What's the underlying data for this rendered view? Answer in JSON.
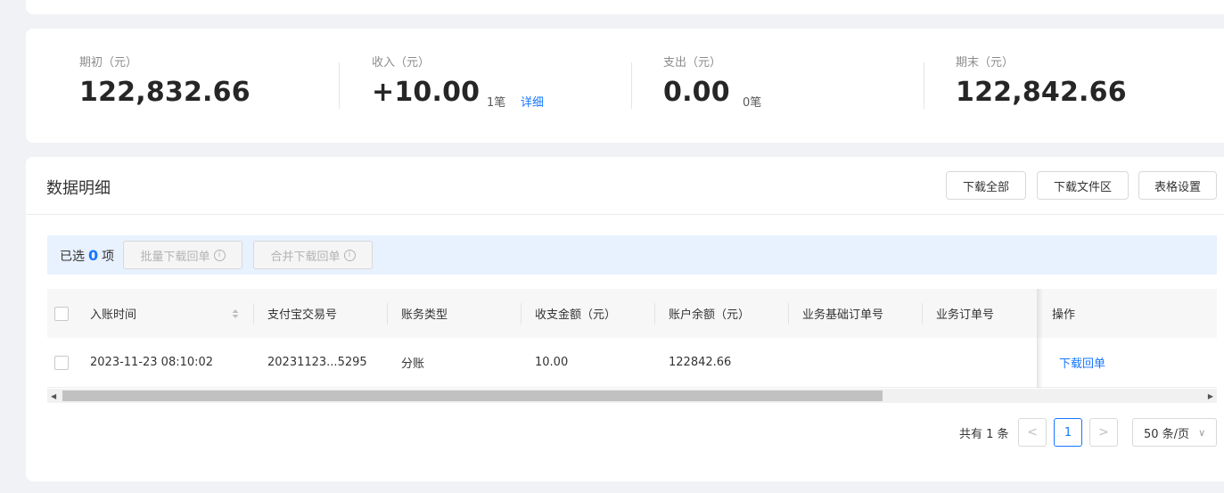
{
  "summary": {
    "opening": {
      "label": "期初（元）",
      "value": "122,832.66"
    },
    "income": {
      "label": "收入（元）",
      "value": "+10.00",
      "count": "1笔",
      "detail_link": "详细"
    },
    "expense": {
      "label": "支出（元）",
      "value": "0.00",
      "count": "0笔"
    },
    "closing": {
      "label": "期末（元）",
      "value": "122,842.66"
    }
  },
  "detail": {
    "title": "数据明细",
    "buttons": {
      "download_all": "下载全部",
      "download_area": "下载文件区",
      "table_settings": "表格设置"
    },
    "selection": {
      "prefix": "已选",
      "count": "0",
      "suffix": "项",
      "batch_download": "批量下载回单",
      "merge_download": "合并下载回单"
    },
    "columns": [
      "入账时间",
      "支付宝交易号",
      "账务类型",
      "收支金额（元）",
      "账户余额（元）",
      "业务基础订单号",
      "业务订单号",
      "操作"
    ],
    "rows": [
      {
        "time": "2023-11-23 08:10:02",
        "trade_no": "20231123...5295",
        "type": "分账",
        "amount": "10.00",
        "balance": "122842.66",
        "base_order": "",
        "order": "",
        "action": "下载回单"
      }
    ],
    "scrollbar": {
      "thumb_fraction": 0.72
    },
    "pagination": {
      "total_text": "共有 1 条",
      "current_page": "1",
      "page_size": "50 条/页",
      "prev": "<",
      "next": ">"
    }
  },
  "icons": {
    "info": "info-circle-icon",
    "sort": "sort-icon",
    "chevron": "chevron-down-icon"
  },
  "colors": {
    "accent": "#1677ff",
    "selection_bar": "#e8f1fe",
    "background": "#f0f2f5"
  }
}
